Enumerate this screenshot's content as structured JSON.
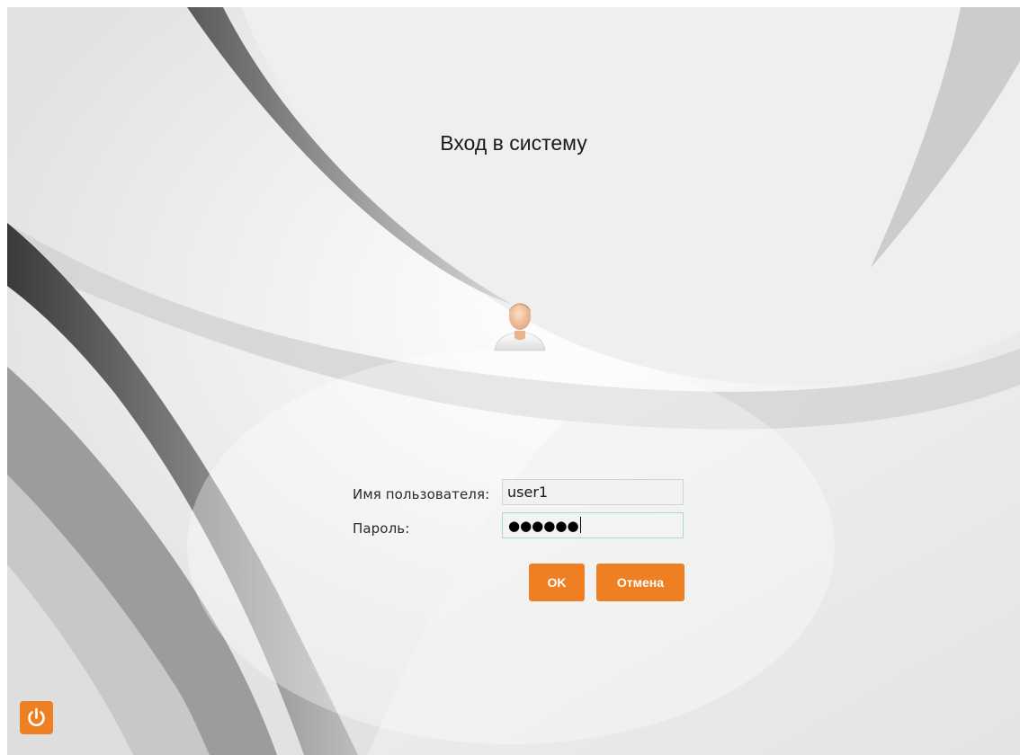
{
  "login": {
    "title": "Вход в систему",
    "username_label": "Имя пользователя:",
    "username_value": "user1",
    "password_label": "Пароль:",
    "password_mask": "●●●●●●",
    "ok_label": "OK",
    "cancel_label": "Отмена"
  },
  "icons": {
    "avatar": "user-avatar-icon",
    "power": "power-icon"
  },
  "colors": {
    "accent": "#ee7f22",
    "background": "#dcdcdc",
    "field_focus_border": "#a8d6dc"
  }
}
